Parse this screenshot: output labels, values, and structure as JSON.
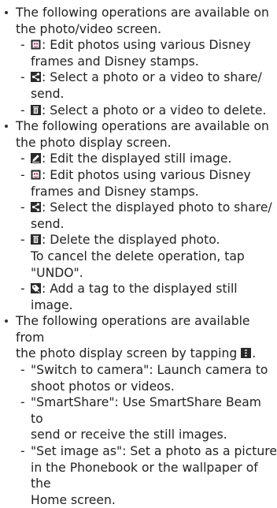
{
  "sections": [
    {
      "intro": [
        "The following operations are available on",
        "the photo/video screen."
      ],
      "items": [
        {
          "icon": "disney-frame-icon",
          "lines": [
            ": Edit photos using various Disney",
            "frames and Disney stamps."
          ]
        },
        {
          "icon": "share-icon",
          "lines": [
            ": Select a photo or a video to share/",
            "send."
          ]
        },
        {
          "icon": "trash-icon",
          "lines": [
            ": Select a photo or a video to delete."
          ]
        }
      ]
    },
    {
      "intro": [
        "The following operations are available on",
        "the photo display screen."
      ],
      "items": [
        {
          "icon": "edit-icon",
          "lines": [
            ": Edit the displayed still image."
          ]
        },
        {
          "icon": "disney-frame-icon",
          "lines": [
            ": Edit photos using various Disney",
            "frames and Disney stamps."
          ]
        },
        {
          "icon": "share-icon",
          "lines": [
            ": Select the displayed photo to share/",
            "send."
          ]
        },
        {
          "icon": "trash-icon",
          "lines": [
            ": Delete the displayed photo.",
            "To cancel the delete operation, tap",
            "\"UNDO\"."
          ]
        },
        {
          "icon": "tag-icon",
          "lines": [
            ": Add a tag to the displayed still image."
          ]
        }
      ]
    },
    {
      "intro": [
        "The following operations are available from",
        "the photo display screen by tapping"
      ],
      "intro_icon": "menu-icon",
      "intro_suffix": ".",
      "items": [
        {
          "lines": [
            "\"Switch to camera\": Launch camera to",
            "shoot photos or videos."
          ]
        },
        {
          "lines": [
            "\"SmartShare\": Use SmartShare Beam to",
            "send or receive the still images."
          ]
        },
        {
          "lines": [
            "\"Set image as\": Set a photo as a picture",
            "in the Phonebook or the wallpaper of the",
            "Home screen."
          ]
        }
      ]
    }
  ],
  "bullet_char": "•",
  "dash_char": "-",
  "colors": {
    "icon_fill": "#2a2a2a",
    "frame_accent": "#b0306a",
    "text": "#222222"
  }
}
